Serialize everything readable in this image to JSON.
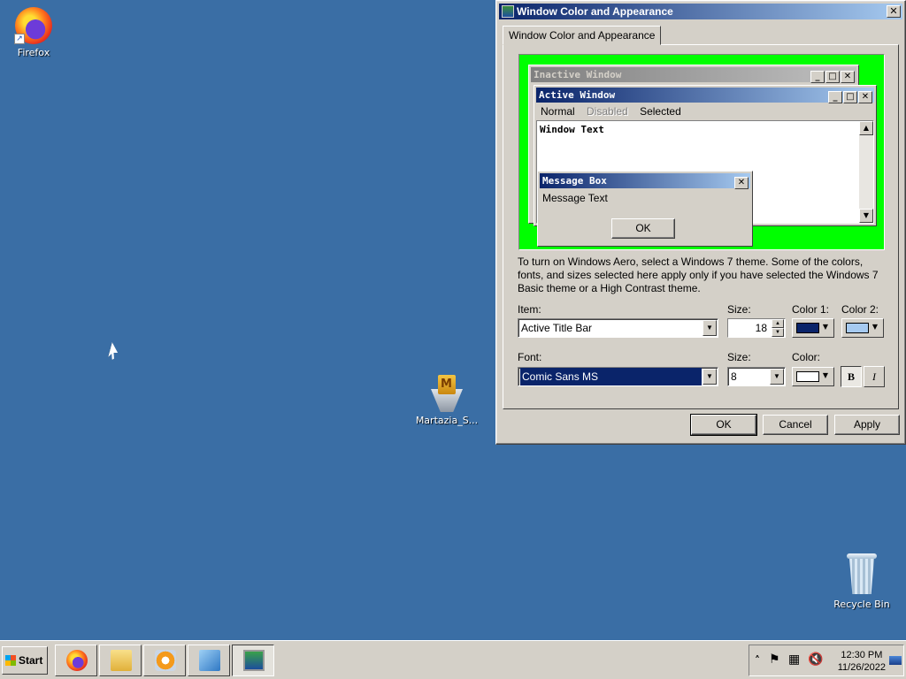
{
  "desktop": {
    "icons": [
      {
        "label": "Firefox"
      },
      {
        "label": "Martazia_S..."
      },
      {
        "label": "Recycle Bin"
      }
    ]
  },
  "dialog": {
    "title": "Window Color and Appearance",
    "close_label": "✕",
    "tab_label": "Window Color and Appearance",
    "preview": {
      "inactive_title": "Inactive Window",
      "active_title": "Active Window",
      "menu_normal": "Normal",
      "menu_disabled": "Disabled",
      "menu_selected": "Selected",
      "window_text": "Window Text",
      "msgbox_title": "Message Box",
      "msgbox_text": "Message Text",
      "msgbox_ok": "OK"
    },
    "description": "To turn on Windows Aero, select a Windows 7 theme.  Some of the colors, fonts, and sizes selected here apply only if you have selected the Windows 7 Basic theme or a High Contrast theme.",
    "item_label": "Item:",
    "item_value": "Active Title Bar",
    "size_label": "Size:",
    "size_value": "18",
    "color1_label": "Color 1:",
    "color2_label": "Color 2:",
    "color1": "#0a246a",
    "color2": "#a6caf0",
    "font_label": "Font:",
    "font_value": "Comic Sans MS",
    "font_size_label": "Size:",
    "font_size_value": "8",
    "font_color_label": "Color:",
    "font_color": "#ffffff",
    "bold_label": "B",
    "italic_label": "I",
    "ok_label": "OK",
    "cancel_label": "Cancel",
    "apply_label": "Apply",
    "preview_bg": "#00ff00"
  },
  "taskbar": {
    "start_label": "Start",
    "clock_time": "12:30 PM",
    "clock_date": "11/26/2022",
    "tray_chevron": "˄"
  }
}
